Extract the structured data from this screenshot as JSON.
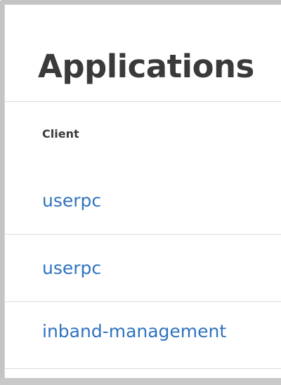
{
  "page": {
    "title": "Applications"
  },
  "table": {
    "column_header": "Client",
    "rows": [
      {
        "client": "userpc"
      },
      {
        "client": "userpc"
      },
      {
        "client": "inband-management"
      }
    ]
  },
  "colors": {
    "link": "#2f73bf",
    "title": "#3a3a3a",
    "divider": "#dcdcdc",
    "frame": "#c4c4c4"
  }
}
